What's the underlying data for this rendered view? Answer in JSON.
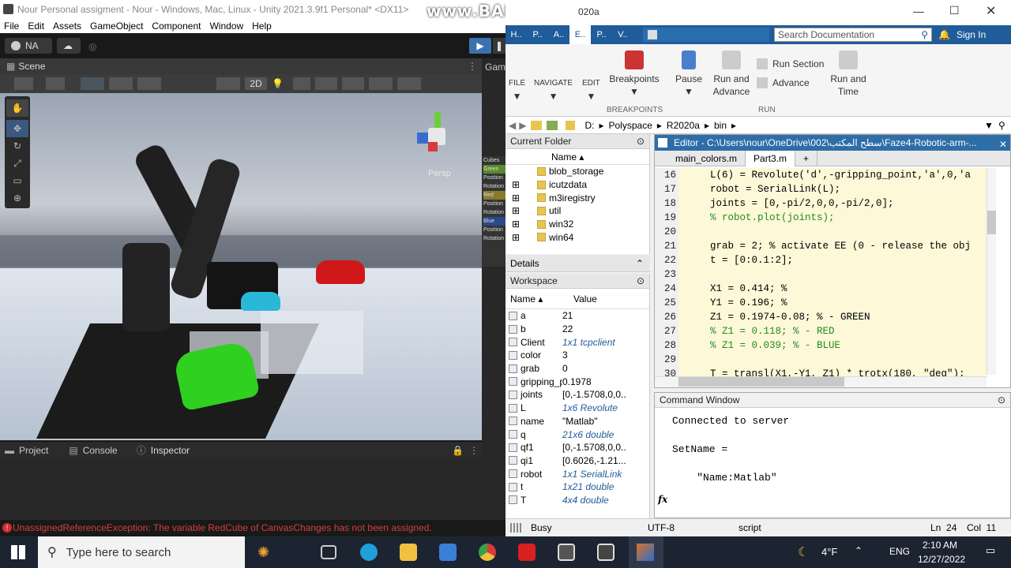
{
  "unity": {
    "window_title": "Nour Personal assigment - Nour - Windows, Mac, Linux - Unity 2021.3.9f1 Personal* <DX11>",
    "menu": [
      "File",
      "Edit",
      "Assets",
      "GameObject",
      "Component",
      "Window",
      "Help"
    ],
    "account": "NA",
    "scene_tab": "Scene",
    "game_tab": "Gam",
    "mode_2d": "2D",
    "persp_label": "Persp",
    "bottom_tabs": [
      "Project",
      "Console",
      "Inspector"
    ],
    "error": "UnassignedReferenceException: The variable RedCube of CanvasChanges has not been assigned.",
    "overlay_lines": [
      "Cubes",
      "Green",
      "Position",
      "Rotation",
      "Red",
      "Position",
      "Rotation",
      "Blue",
      "Position",
      "Rotation"
    ]
  },
  "bandicam": "www.BANDICAM.com",
  "matlab": {
    "title_suffix": "020a",
    "quick_tabs": [
      "H..",
      "P..",
      "A..",
      "E..",
      "P..",
      "V.."
    ],
    "search_placeholder": "Search Documentation",
    "sign_in": "Sign In",
    "ribbon": {
      "file": "FILE",
      "navigate": "NAVIGATE",
      "edit": "EDIT",
      "breakpoints": "Breakpoints",
      "breakpoints_group": "BREAKPOINTS",
      "pause": "Pause",
      "run_and_advance": "Run and Advance",
      "run_section": "Run Section",
      "advance": "Advance",
      "run_and_time": "Run and Time",
      "run_group": "RUN"
    },
    "address": [
      "D:",
      "Polyspace",
      "R2020a",
      "bin"
    ],
    "current_folder": {
      "header": "Current Folder",
      "col": "Name",
      "items": [
        "blob_storage",
        "icutzdata",
        "m3iregistry",
        "util",
        "win32",
        "win64"
      ]
    },
    "details": "Details",
    "workspace": {
      "header": "Workspace",
      "col_name": "Name",
      "col_value": "Value",
      "rows": [
        {
          "name": "a",
          "value": "21"
        },
        {
          "name": "b",
          "value": "22"
        },
        {
          "name": "Client",
          "value": "1x1 tcpclient"
        },
        {
          "name": "color",
          "value": "3"
        },
        {
          "name": "grab",
          "value": "0"
        },
        {
          "name": "gripping_p...",
          "value": "0.1978"
        },
        {
          "name": "joints",
          "value": "[0,-1.5708,0,0..."
        },
        {
          "name": "L",
          "value": "1x6 Revolute"
        },
        {
          "name": "name",
          "value": "\"Matlab\""
        },
        {
          "name": "q",
          "value": "21x6 double"
        },
        {
          "name": "qf1",
          "value": "[0,-1.5708,0,0..."
        },
        {
          "name": "qi1",
          "value": "[0.6026,-1.21..."
        },
        {
          "name": "robot",
          "value": "1x1 SerialLink"
        },
        {
          "name": "t",
          "value": "1x21 double"
        },
        {
          "name": "T",
          "value": "4x4 double"
        }
      ]
    },
    "editor": {
      "title": "Editor - C:\\Users\\nour\\OneDrive\\002\\سطح المكتب\\Faze4-Robotic-arm-...",
      "tabs": [
        "main_colors.m",
        "Part3.m"
      ],
      "lines": [
        {
          "n": "16",
          "code": "L(6) = Revolute('d',-gripping_point,'a',0,'a"
        },
        {
          "n": "17",
          "code": "robot = SerialLink(L);"
        },
        {
          "n": "18",
          "code": "joints = [0,-pi/2,0,0,-pi/2,0];"
        },
        {
          "n": "19",
          "code": "% robot.plot(joints);"
        },
        {
          "n": "20",
          "code": ""
        },
        {
          "n": "21",
          "code": "grab = 2; % activate EE (0 - release the obj"
        },
        {
          "n": "22",
          "code": "t = [0:0.1:2];"
        },
        {
          "n": "23",
          "code": ""
        },
        {
          "n": "24",
          "code": "X1 = 0.414; %"
        },
        {
          "n": "25",
          "code": "Y1 = 0.196; %"
        },
        {
          "n": "26",
          "code": "Z1 = 0.1974-0.08; % - GREEN"
        },
        {
          "n": "27",
          "code": "% Z1 = 0.118; % - RED"
        },
        {
          "n": "28",
          "code": "% Z1 = 0.039; % - BLUE"
        },
        {
          "n": "29",
          "code": ""
        },
        {
          "n": "30",
          "code": "T = transl(X1,-Y1, Z1) * trotx(180, \"deg\");"
        }
      ]
    },
    "command_window": {
      "header": "Command Window",
      "lines": [
        "Connected to server",
        "",
        "SetName =",
        "",
        "    \"Name:Matlab\""
      ],
      "prompt": "fx"
    },
    "status": {
      "busy": "Busy",
      "encoding": "UTF-8",
      "type": "script",
      "ln": "Ln  24",
      "col": "Col  11"
    }
  },
  "taskbar": {
    "search_placeholder": "Type here to search",
    "weather": "4°F",
    "lang": "ENG",
    "time": "2:10 AM",
    "date": "12/27/2022"
  }
}
